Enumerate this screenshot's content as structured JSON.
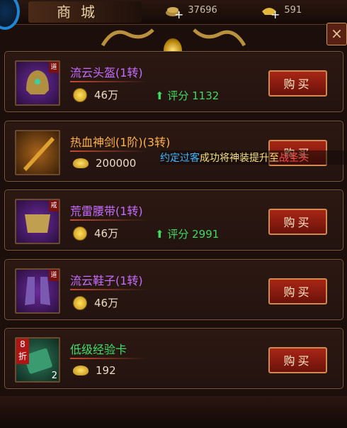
{
  "header": {
    "title": "商城",
    "resource_1": {
      "icon": "gold-coins-icon",
      "value": "37696"
    },
    "resource_2": {
      "icon": "gold-ingot-icon",
      "value": "591"
    },
    "close_label": "×"
  },
  "items": [
    {
      "name": "流云头盔(1转)",
      "price": "46万",
      "price_icon": "coin",
      "score": "评分 1132",
      "buy_label": "购买",
      "badge": "道",
      "color": "#c56dff"
    },
    {
      "name": "热血神剑(1阶)(3转)",
      "price": "200000",
      "price_icon": "ingot",
      "buy_label": "购买",
      "color": "#ffb24a"
    },
    {
      "name": "荒雷腰带(1转)",
      "price": "46万",
      "price_icon": "coin",
      "score": "评分 2991",
      "buy_label": "购买",
      "badge": "戒",
      "color": "#c56dff"
    },
    {
      "name": "流云鞋子(1转)",
      "price": "46万",
      "price_icon": "coin",
      "buy_label": "购买",
      "badge": "道",
      "color": "#c56dff"
    },
    {
      "name": "低级经验卡",
      "price": "192",
      "price_icon": "ingot",
      "buy_label": "购买",
      "discount": "8折",
      "count": "2",
      "color": "#3fe06c"
    }
  ],
  "chat_message": {
    "part1": "约定过客",
    "part2": "成功将神装提升至",
    "part3": "战圣头"
  }
}
